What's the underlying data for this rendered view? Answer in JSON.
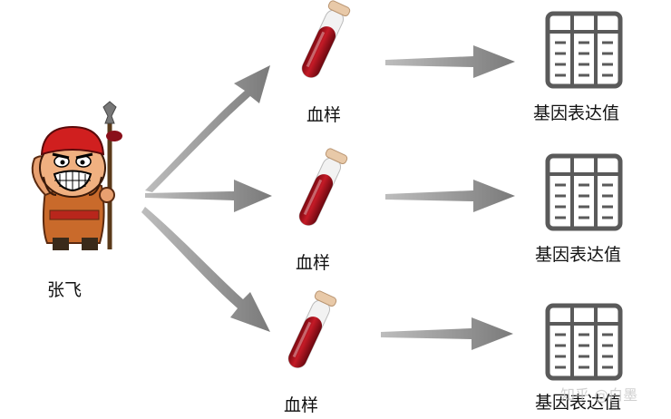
{
  "person": {
    "name": "张飞"
  },
  "samples": [
    {
      "label": "血样"
    },
    {
      "label": "血样"
    },
    {
      "label": "血样"
    }
  ],
  "outputs": [
    {
      "label": "基因表达值"
    },
    {
      "label": "基因表达值"
    },
    {
      "label": "基因表达值"
    }
  ],
  "watermark": "知乎 @白墨",
  "colors": {
    "arrow": "#8c8c8c",
    "blood": "#a80f1a",
    "table": "#5a5a5a"
  }
}
